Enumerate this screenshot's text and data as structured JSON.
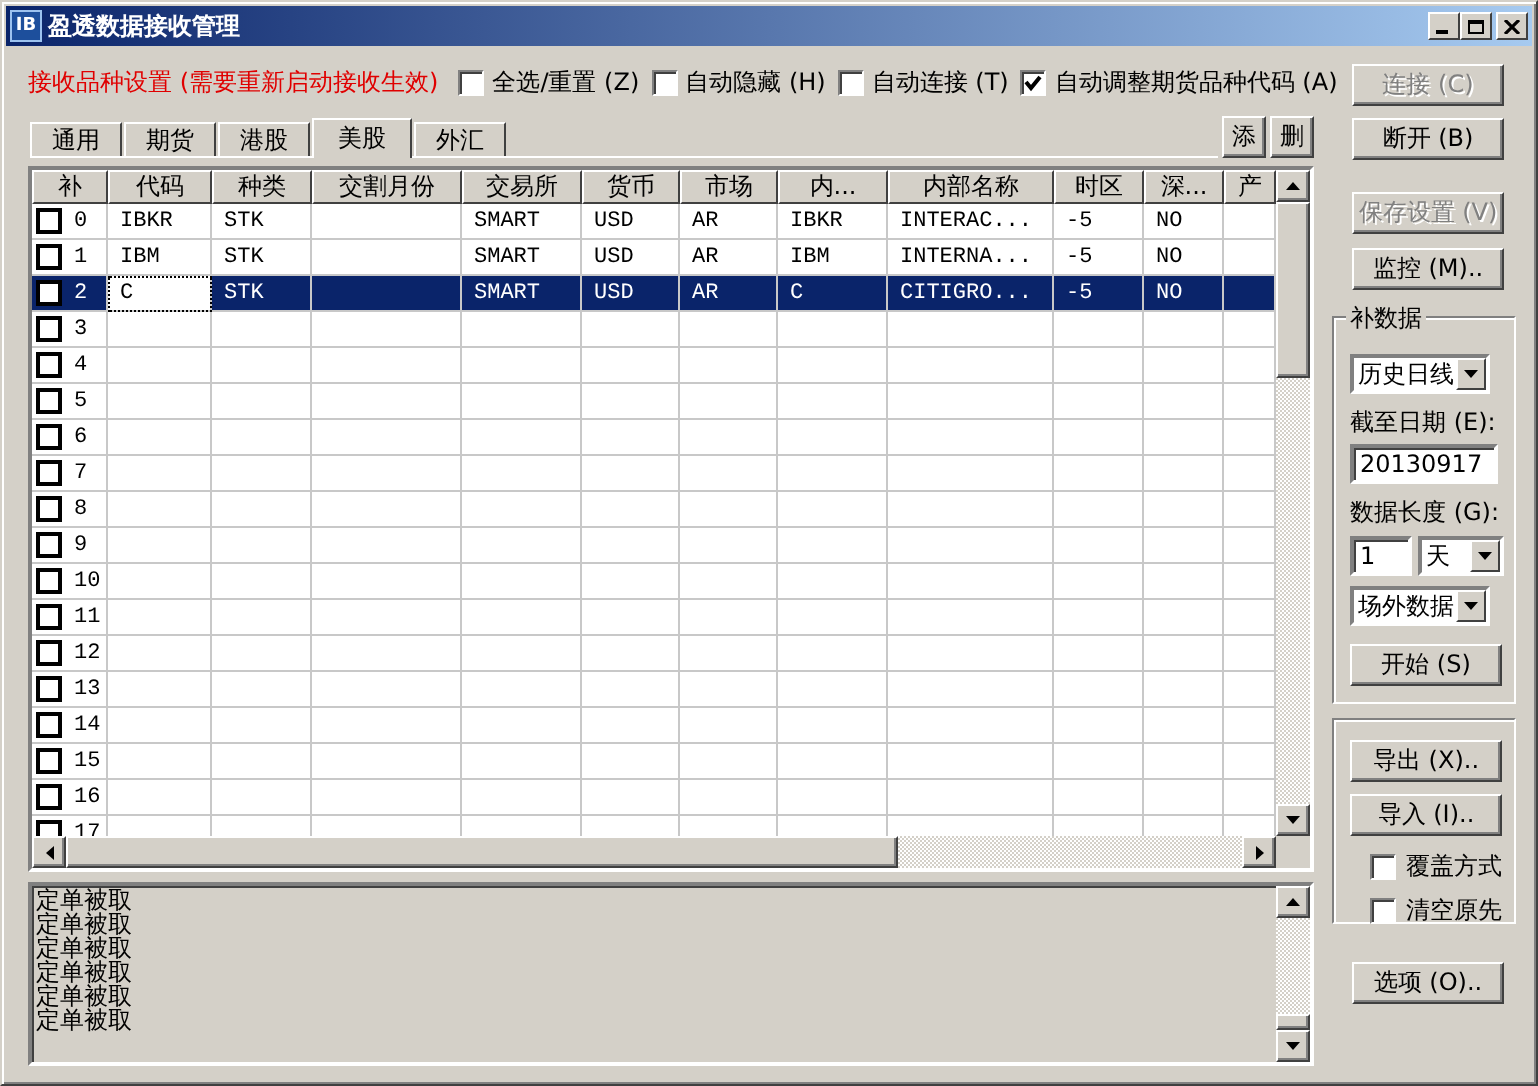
{
  "window": {
    "icon_text": "IB",
    "title": "盈透数据接收管理"
  },
  "settings_label": "接收品种设置 (需要重新启动接收生效)",
  "options": [
    {
      "label": "全选/重置 (Z)",
      "checked": false
    },
    {
      "label": "自动隐藏 (H)",
      "checked": false
    },
    {
      "label": "自动连接 (T)",
      "checked": false
    },
    {
      "label": "自动调整期货品种代码 (A)",
      "checked": true
    }
  ],
  "tabs": [
    {
      "label": "通用",
      "selected": false
    },
    {
      "label": "期货",
      "selected": false
    },
    {
      "label": "港股",
      "selected": false
    },
    {
      "label": "美股",
      "selected": true
    },
    {
      "label": "外汇",
      "selected": false
    }
  ],
  "tab_buttons": [
    "添",
    "删"
  ],
  "grid": {
    "columns": [
      "补",
      "代码",
      "种类",
      "交割月份",
      "交易所",
      "货币",
      "市场",
      "内...",
      "内部名称",
      "时区",
      "深...",
      "产"
    ],
    "rows": [
      {
        "number": "0",
        "checked": false,
        "selected": false,
        "code_focused": false,
        "code": "IBKR",
        "type": "STK",
        "exchange": "SMART",
        "currency": "USD",
        "market": "AR",
        "internal": "IBKR",
        "internal_name": "INTERAC...",
        "timezone": "-5",
        "depth": "NO"
      },
      {
        "number": "1",
        "checked": false,
        "selected": false,
        "code_focused": false,
        "code": "IBM",
        "type": "STK",
        "exchange": "SMART",
        "currency": "USD",
        "market": "AR",
        "internal": "IBM",
        "internal_name": "INTERNA...",
        "timezone": "-5",
        "depth": "NO"
      },
      {
        "number": "2",
        "checked": false,
        "selected": true,
        "code_focused": true,
        "code": "C",
        "type": "STK",
        "exchange": "SMART",
        "currency": "USD",
        "market": "AR",
        "internal": "C",
        "internal_name": "CITIGRO...",
        "timezone": "-5",
        "depth": "NO"
      },
      {
        "number": "3",
        "checked": false,
        "selected": false,
        "code_focused": false
      },
      {
        "number": "4",
        "checked": false,
        "selected": false,
        "code_focused": false
      },
      {
        "number": "5",
        "checked": false,
        "selected": false,
        "code_focused": false
      },
      {
        "number": "6",
        "checked": false,
        "selected": false,
        "code_focused": false
      },
      {
        "number": "7",
        "checked": false,
        "selected": false,
        "code_focused": false
      },
      {
        "number": "8",
        "checked": false,
        "selected": false,
        "code_focused": false
      },
      {
        "number": "9",
        "checked": false,
        "selected": false,
        "code_focused": false
      },
      {
        "number": "10",
        "checked": false,
        "selected": false,
        "code_focused": false
      },
      {
        "number": "11",
        "checked": false,
        "selected": false,
        "code_focused": false
      },
      {
        "number": "12",
        "checked": false,
        "selected": false,
        "code_focused": false
      },
      {
        "number": "13",
        "checked": false,
        "selected": false,
        "code_focused": false
      },
      {
        "number": "14",
        "checked": false,
        "selected": false,
        "code_focused": false
      },
      {
        "number": "15",
        "checked": false,
        "selected": false,
        "code_focused": false
      },
      {
        "number": "16",
        "checked": false,
        "selected": false,
        "code_focused": false
      },
      {
        "number": "17",
        "checked": false,
        "selected": false,
        "code_focused": false
      }
    ]
  },
  "log": [
    "定单被取",
    "定单被取",
    "定单被取",
    "定单被取",
    "定单被取",
    "定单被取"
  ],
  "side": {
    "top_buttons": [
      {
        "label": "连接 (C)",
        "disabled": true
      },
      {
        "label": "断开 (B)",
        "disabled": false
      },
      {
        "label": "保存设置 (V)",
        "disabled": true
      },
      {
        "label": "监控 (M)..",
        "disabled": false
      }
    ],
    "backfill": {
      "title": "补数据",
      "source": "历史日线",
      "end_date_label": "截至日期 (E):",
      "end_date": "20130917",
      "length_label": "数据长度 (G):",
      "length": "1",
      "unit": "天",
      "data_type": "场外数据",
      "start_button": "开始 (S)"
    },
    "io": {
      "buttons": [
        "导出 (X)..",
        "导入 (I).."
      ],
      "checks": [
        {
          "label": "覆盖方式",
          "checked": false
        },
        {
          "label": "清空原先",
          "checked": false
        }
      ]
    },
    "options_button": "选项 (O).."
  }
}
